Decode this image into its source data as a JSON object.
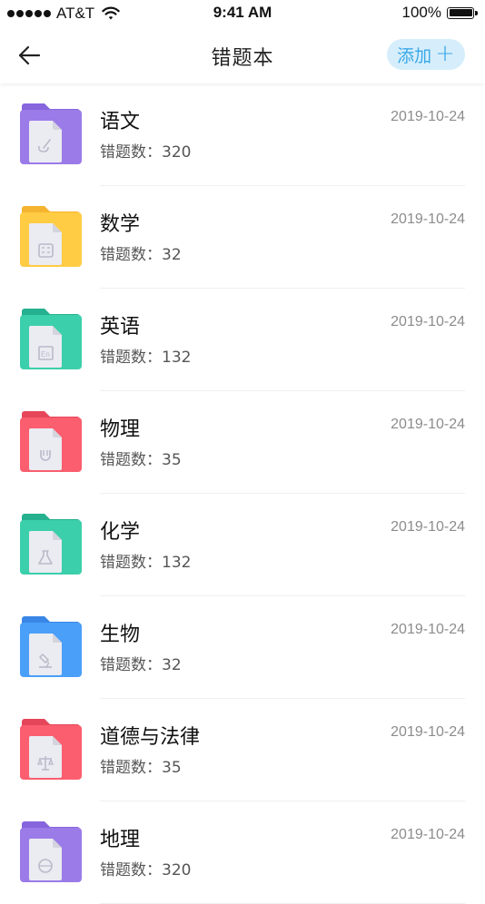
{
  "status_bar": {
    "carrier": "AT&T",
    "time": "9:41 AM",
    "battery": "100%"
  },
  "nav": {
    "title": "错题本",
    "add_label": "添加",
    "add_symbol": "+"
  },
  "count_label": "错题数：",
  "items": [
    {
      "name": "语文",
      "count": "320",
      "date": "2019-10-24",
      "color": "#9b7be8",
      "tab_color": "#8665dd",
      "icon": "brush-icon"
    },
    {
      "name": "数学",
      "count": "32",
      "date": "2019-10-24",
      "color": "#ffcc44",
      "tab_color": "#f5b42f",
      "icon": "calculator-icon"
    },
    {
      "name": "英语",
      "count": "132",
      "date": "2019-10-24",
      "color": "#3ccfab",
      "tab_color": "#25b08f",
      "icon": "en-icon"
    },
    {
      "name": "物理",
      "count": "35",
      "date": "2019-10-24",
      "color": "#fb5e6e",
      "tab_color": "#e6465a",
      "icon": "magnet-icon"
    },
    {
      "name": "化学",
      "count": "132",
      "date": "2019-10-24",
      "color": "#3ccfab",
      "tab_color": "#25b08f",
      "icon": "flask-icon"
    },
    {
      "name": "生物",
      "count": "32",
      "date": "2019-10-24",
      "color": "#4a9ff9",
      "tab_color": "#3a86e6",
      "icon": "microscope-icon"
    },
    {
      "name": "道德与法律",
      "count": "35",
      "date": "2019-10-24",
      "color": "#fb5e6e",
      "tab_color": "#e6465a",
      "icon": "scales-icon"
    },
    {
      "name": "地理",
      "count": "320",
      "date": "2019-10-24",
      "color": "#9b7be8",
      "tab_color": "#8665dd",
      "icon": "globe-icon"
    }
  ]
}
